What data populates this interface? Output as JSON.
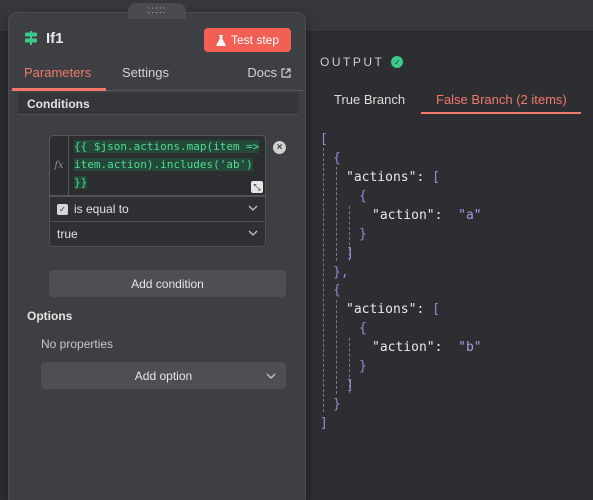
{
  "panel": {
    "drag_handle": ":::::",
    "node_title": "If1",
    "test_step_label": "Test step",
    "tabs": [
      "Parameters",
      "Settings"
    ],
    "docs_label": "Docs",
    "conditions": {
      "section_title": "Conditions",
      "fx_label": "fx",
      "expression_lines": [
        "{{ $json.actions.map(item =>",
        "item.action).includes('ab')",
        "}}"
      ],
      "operator_label": "is equal to",
      "value": "true",
      "add_condition_label": "Add condition"
    },
    "options": {
      "section_title": "Options",
      "empty_text": "No properties",
      "add_option_label": "Add option"
    }
  },
  "output": {
    "title": "OUTPUT",
    "tabs": [
      "True Branch",
      "False Branch (2 items)"
    ],
    "json": [
      {
        "key": "actions",
        "value": "a"
      },
      {
        "key": "actions",
        "value": "b"
      }
    ],
    "inner_key": "action"
  },
  "colors": {
    "accent": "#f2786c",
    "button": "#f25f55",
    "success": "#3cc98a",
    "code_green": "#4fdc8f"
  }
}
